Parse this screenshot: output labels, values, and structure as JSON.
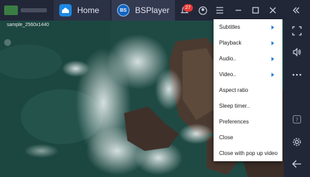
{
  "tabs": {
    "home_label": "Home",
    "app_label": "BSPlayer",
    "app_icon_text": "BS"
  },
  "notifications": {
    "count": "27"
  },
  "video": {
    "filename": "sample_2560x1440",
    "subtitle_link": " "
  },
  "menu": {
    "items": [
      {
        "label": "Subtitles",
        "submenu": true
      },
      {
        "label": "Playback",
        "submenu": true
      },
      {
        "label": "Audio..",
        "submenu": true
      },
      {
        "label": "Video..",
        "submenu": true
      },
      {
        "label": "Aspect ratio",
        "submenu": false
      },
      {
        "label": "Sleep timer..",
        "submenu": false
      },
      {
        "label": "Preferences",
        "submenu": false
      },
      {
        "label": "Close",
        "submenu": false
      },
      {
        "label": "Close with pop up video",
        "submenu": false
      }
    ]
  },
  "colors": {
    "accent": "#2a7be4",
    "titlebar": "#222738",
    "badge": "#e53935"
  }
}
